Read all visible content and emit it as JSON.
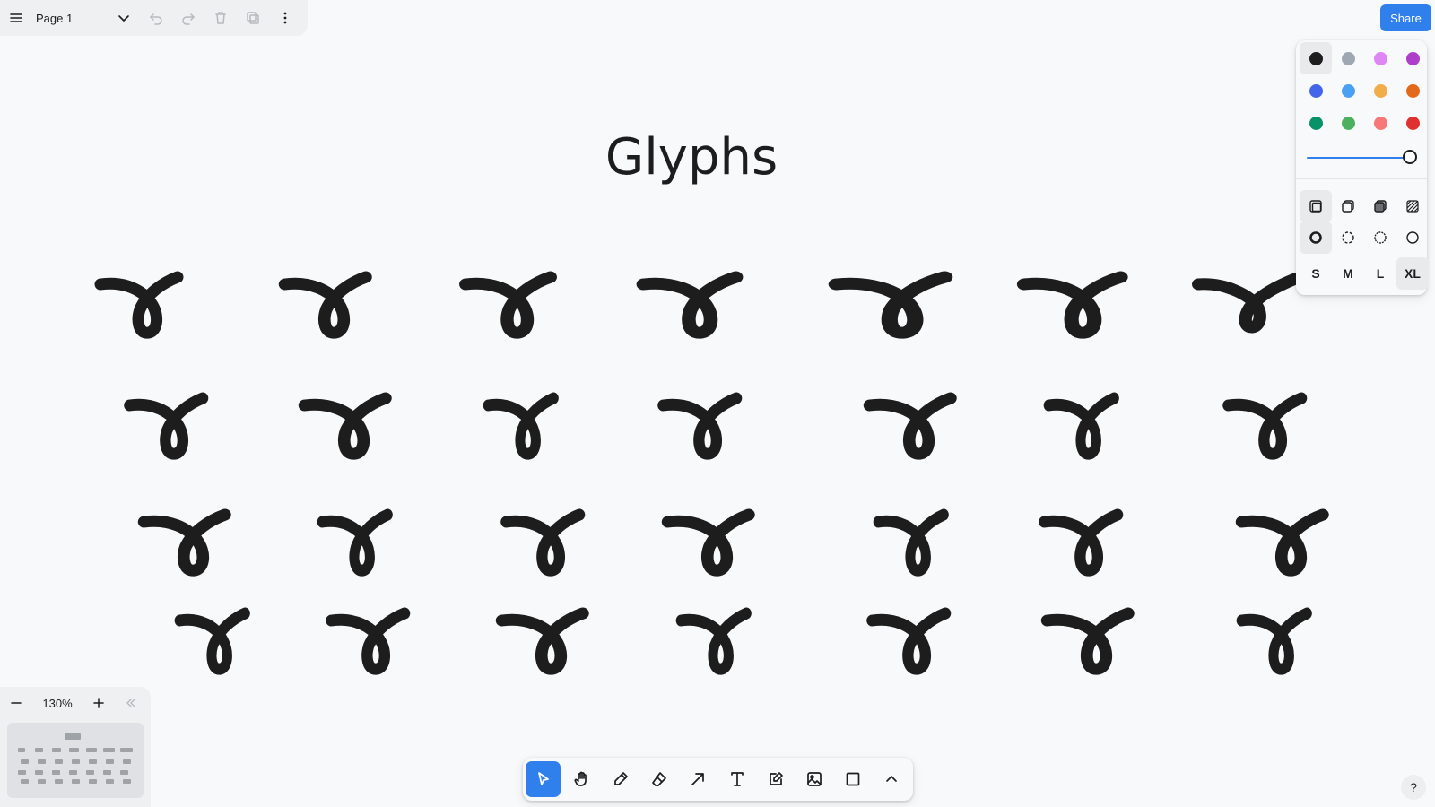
{
  "menu": {
    "page_name": "Page 1",
    "icons": [
      "hamburger-icon",
      "chevron-down-icon",
      "undo-icon",
      "redo-icon",
      "trash-icon",
      "duplicate-icon",
      "more-vertical-icon"
    ]
  },
  "share": {
    "label": "Share",
    "color": "#2f80ed"
  },
  "canvas": {
    "title": "Glyphs",
    "glyph_rows": 4,
    "glyph_columns": 7
  },
  "style_panel": {
    "colors": [
      "#1d1d1d",
      "#9fa8b2",
      "#e085f4",
      "#ae3ec9",
      "#4465e9",
      "#4ba1f1",
      "#f1ac4b",
      "#e16919",
      "#099268",
      "#4cb05e",
      "#f87777",
      "#e03131"
    ],
    "selected_color": "#1d1d1d",
    "opacity": 1.0,
    "fill_options": [
      "fill-none-icon",
      "fill-semi-icon",
      "fill-solid-icon",
      "fill-pattern-icon"
    ],
    "selected_fill": "fill-none-icon",
    "dash_options": [
      "dash-draw-icon",
      "dash-dashed-icon",
      "dash-dotted-icon",
      "dash-solid-icon"
    ],
    "selected_dash": "dash-draw-icon",
    "sizes": [
      "S",
      "M",
      "L",
      "XL"
    ],
    "selected_size": "XL"
  },
  "zoom": {
    "value": "130%"
  },
  "toolbar": {
    "tools": [
      "select-icon",
      "hand-icon",
      "draw-icon",
      "eraser-icon",
      "arrow-icon",
      "text-icon",
      "note-icon",
      "image-icon",
      "rectangle-icon",
      "chevron-up-icon"
    ],
    "active_tool": "select-icon"
  },
  "help": {
    "label": "?"
  }
}
